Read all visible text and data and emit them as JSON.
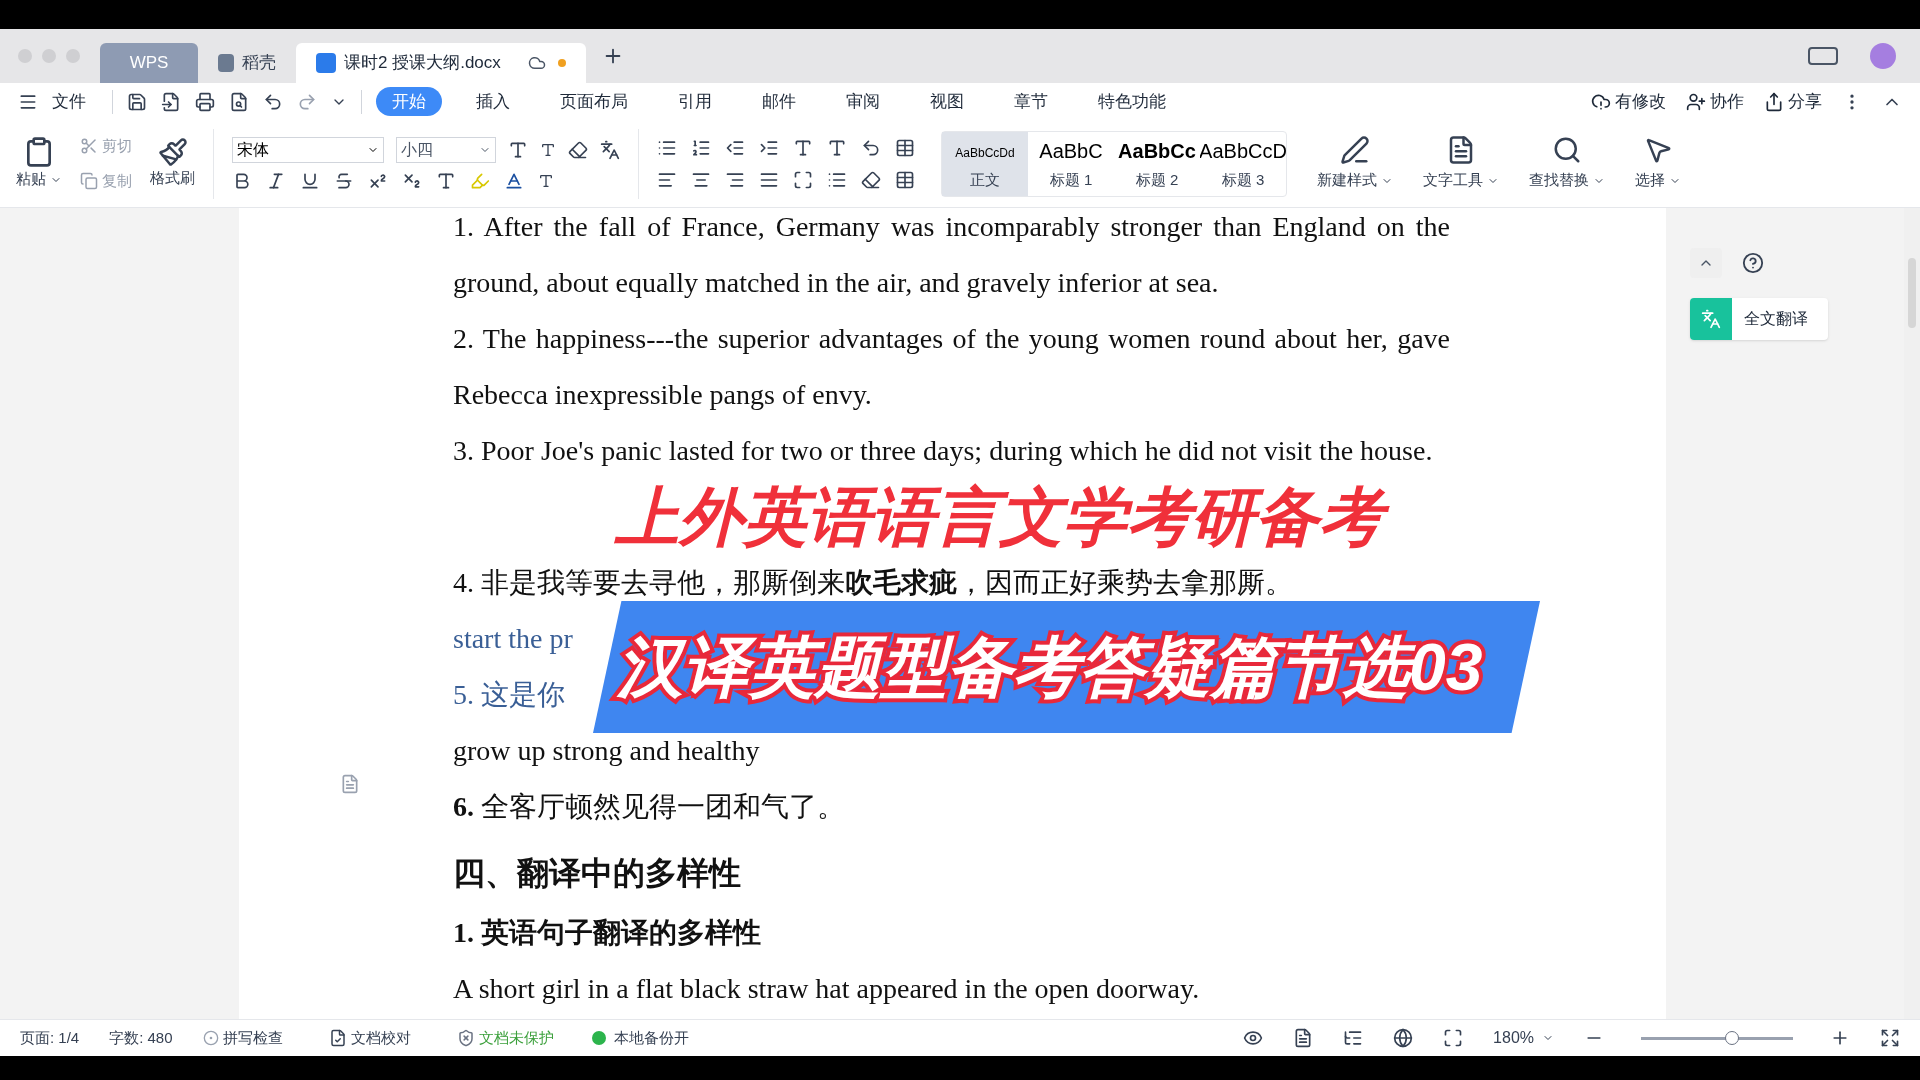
{
  "tab_bar": {
    "tabs": [
      {
        "label": "WPS",
        "kind": "home",
        "selected": false
      },
      {
        "label": "稻壳",
        "kind": "store",
        "selected": false
      },
      {
        "label": "课时2 授课大纲.docx",
        "kind": "doc",
        "selected": true,
        "unsaved": true
      }
    ]
  },
  "menu": {
    "file": "文件",
    "tabs": [
      {
        "label": "开始",
        "selected": true
      },
      {
        "label": "插入",
        "selected": false
      },
      {
        "label": "页面布局",
        "selected": false
      },
      {
        "label": "引用",
        "selected": false
      },
      {
        "label": "邮件",
        "selected": false
      },
      {
        "label": "审阅",
        "selected": false
      },
      {
        "label": "视图",
        "selected": false
      },
      {
        "label": "章节",
        "selected": false
      },
      {
        "label": "特色功能",
        "selected": false
      }
    ],
    "actions": [
      "有修改",
      "协作",
      "分享"
    ]
  },
  "ribbon": {
    "paste": "粘贴",
    "cut": {
      "label": "剪切",
      "disabled": true
    },
    "copy": {
      "label": "复制",
      "disabled": true
    },
    "format_painter": "格式刷",
    "font": "宋体",
    "size": "小四",
    "styles": [
      {
        "preview": "AaBbCcDd",
        "label": "正文",
        "selected": true
      },
      {
        "preview": "AaBbC",
        "label": "标题 1",
        "selected": false
      },
      {
        "preview": "AaBbCc",
        "label": "标题 2",
        "selected": false
      },
      {
        "preview": "AaBbCcD",
        "label": "标题 3",
        "selected": false
      }
    ],
    "tools": [
      "新建样式",
      "文字工具",
      "查找替换",
      "选择"
    ]
  },
  "document": {
    "blocks": [
      {
        "kind": "para",
        "text": "1. After the fall of France, Germany was incomparably stronger than England on the ground, about equally matched in the air, and gravely inferior at sea."
      },
      {
        "kind": "para",
        "text": "2. The happiness---the superior advantages of the young women round about her, gave Rebecca inexpressible pangs of envy."
      },
      {
        "kind": "para",
        "text": "3. Poor Joe's panic lasted for two or three days; during which he did not visit the house."
      },
      {
        "kind": "para",
        "text": "4. 非是我等要去寻他，那厮倒来**吹毛求疵**，因而正好乘势去拿那厮。"
      },
      {
        "kind": "faded",
        "text": "start the pr"
      },
      {
        "kind": "faded",
        "text": "5. 这是你"
      },
      {
        "kind": "para",
        "text": "grow up strong and healthy"
      },
      {
        "kind": "para",
        "text": "**6.** 全客厅顿然见得一团和气了。"
      },
      {
        "kind": "heading",
        "text": "四、翻译中的多样性"
      },
      {
        "kind": "subheading",
        "text": "1. 英语句子翻译的多样性"
      },
      {
        "kind": "para",
        "text": "A short girl in a flat black straw hat appeared in the open doorway."
      }
    ]
  },
  "overlay": {
    "title": "上外英语语言文学考研备考",
    "subtitle": "汉译英题型备考答疑篇节选03"
  },
  "side_panel": {
    "translate": "全文翻译"
  },
  "status_bar": {
    "page": "页面: 1/4",
    "words": "字数: 480",
    "spell": "拼写检查",
    "proof": "文档校对",
    "protect": "文档未保护",
    "backup": "本地备份开",
    "zoom": "180%",
    "zoom_level": {
      "level": 0.6
    }
  }
}
